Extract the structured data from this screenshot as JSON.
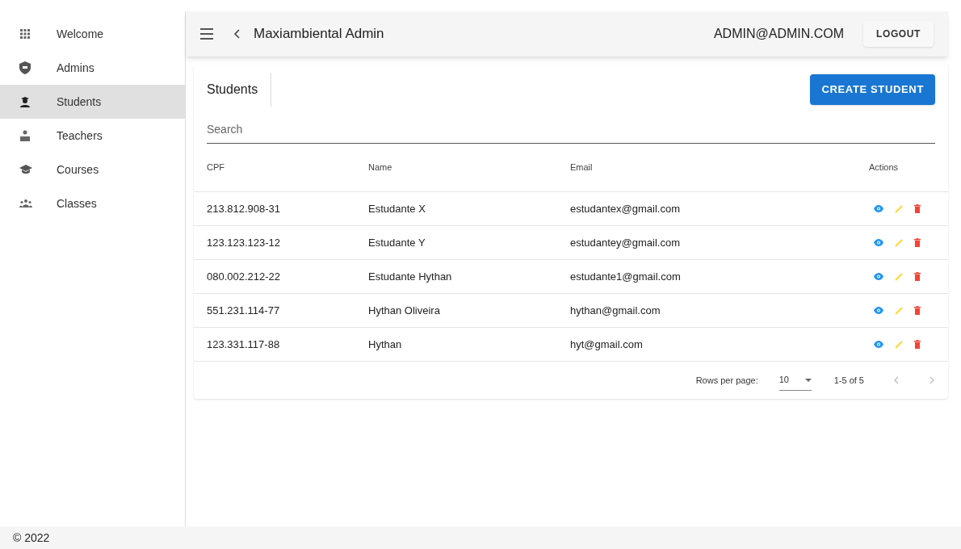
{
  "sidebar": {
    "items": [
      {
        "label": "Welcome",
        "selected": false
      },
      {
        "label": "Admins",
        "selected": false
      },
      {
        "label": "Students",
        "selected": true
      },
      {
        "label": "Teachers",
        "selected": false
      },
      {
        "label": "Courses",
        "selected": false
      },
      {
        "label": "Classes",
        "selected": false
      }
    ]
  },
  "app_bar": {
    "title": "Maxiambiental Admin",
    "user": "ADMIN@ADMIN.COM",
    "logout": "LOGOUT"
  },
  "card": {
    "title": "Students",
    "create_button": "CREATE STUDENT",
    "search": {
      "placeholder": "Search"
    }
  },
  "table": {
    "columns": [
      "CPF",
      "Name",
      "Email",
      "Actions"
    ],
    "rows": [
      [
        "213.812.908-31",
        "Estudante X",
        "estudantex@gmail.com"
      ],
      [
        "123.123.123-12",
        "Estudante Y",
        "estudantey@gmail.com"
      ],
      [
        "080.002.212-22",
        "Estudante Hythan",
        "estudante1@gmail.com"
      ],
      [
        "551.231.114-77",
        "Hythan Oliveira",
        "hythan@gmail.com"
      ],
      [
        "123.331.117-88",
        "Hythan",
        "hyt@gmail.com"
      ]
    ]
  },
  "pagination": {
    "rows_per_page_label": "Rows per page:",
    "rows_per_page": "10",
    "range": "1-5 of 5",
    "prev_disabled": true,
    "next_disabled": true
  },
  "footer": {
    "text": "© 2022"
  }
}
